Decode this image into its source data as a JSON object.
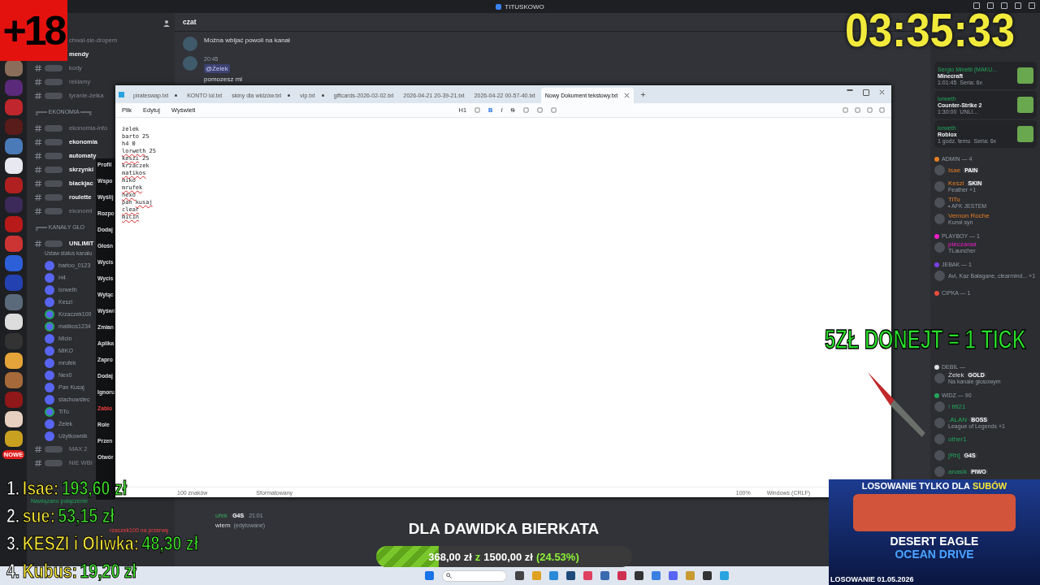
{
  "window": {
    "title": "TITUSKOWO"
  },
  "age_badge": "+18",
  "timer": "03:35:33",
  "channels": {
    "items": [
      {
        "kind": "text",
        "name": "chwal-sie-dropem",
        "unread": false
      },
      {
        "kind": "text",
        "name": "mendy",
        "unread": true
      },
      {
        "kind": "text",
        "name": "kody",
        "unread": false
      },
      {
        "kind": "text",
        "name": "reklamy",
        "unread": false
      },
      {
        "kind": "text",
        "name": "tyranie-żelka",
        "unread": false
      },
      {
        "kind": "category",
        "name": "╔══ EKONOMIA ══╗"
      },
      {
        "kind": "text",
        "name": "ekonomia-info",
        "unread": false
      },
      {
        "kind": "text",
        "name": "ekonomia",
        "unread": true
      },
      {
        "kind": "text",
        "name": "automaty",
        "unread": true
      },
      {
        "kind": "text",
        "name": "skrzynki",
        "unread": true
      },
      {
        "kind": "text",
        "name": "blackjac",
        "unread": true
      },
      {
        "kind": "text",
        "name": "roulette",
        "unread": true
      },
      {
        "kind": "text",
        "name": "ekonomi",
        "unread": false
      },
      {
        "kind": "category",
        "name": "╔══ KANAŁY GŁO"
      },
      {
        "kind": "voice",
        "name": "UNLIMIT",
        "unread": true,
        "status": "Ustaw status kanału"
      }
    ],
    "voice_users": [
      {
        "name": "bartoo_0123",
        "speaking": false
      },
      {
        "name": "H4",
        "speaking": false
      },
      {
        "name": "lorweth",
        "speaking": false
      },
      {
        "name": "Keszi",
        "speaking": false
      },
      {
        "name": "Krzaczek100",
        "speaking": true
      },
      {
        "name": "matikos1234",
        "speaking": true
      },
      {
        "name": "Micin",
        "speaking": false
      },
      {
        "name": "MIKO",
        "speaking": false
      },
      {
        "name": "mrufek",
        "speaking": false
      },
      {
        "name": "Nex0",
        "speaking": false
      },
      {
        "name": "Pan Kusaj",
        "speaking": false
      },
      {
        "name": "stachuwstec",
        "speaking": false
      },
      {
        "name": "TiTo",
        "speaking": true
      },
      {
        "name": "Żelek",
        "speaking": false
      },
      {
        "name": "Użytkownik",
        "speaking": false
      }
    ],
    "more_voice": [
      "MAX 2",
      "NIE WBI"
    ],
    "new_badge": "NOWE",
    "connection": "Nawiązano połączenie"
  },
  "context_menu": [
    {
      "label": "Profil",
      "danger": false
    },
    {
      "label": "Wspo",
      "danger": false
    },
    {
      "label": "Wyślij",
      "danger": false
    },
    {
      "label": "Rozpo",
      "danger": false
    },
    {
      "label": "Dodaj",
      "danger": false
    },
    {
      "label": "Głośn",
      "danger": false
    },
    {
      "label": "Wycis",
      "danger": false
    },
    {
      "label": "Wycis",
      "danger": false
    },
    {
      "label": "Wyłąc",
      "danger": false
    },
    {
      "label": "Wyświ",
      "danger": false
    },
    {
      "label": "Zmian",
      "danger": false
    },
    {
      "label": "Aplika",
      "danger": false
    },
    {
      "label": "Zapro",
      "danger": false
    },
    {
      "label": "Dodaj",
      "danger": false
    },
    {
      "label": "Ignoru",
      "danger": false
    },
    {
      "label": "Zablo",
      "danger": true
    },
    {
      "label": "Role",
      "danger": false
    },
    {
      "label": "Przen",
      "danger": false
    },
    {
      "label": "Otwór",
      "danger": false
    }
  ],
  "chat": {
    "channel": "czat",
    "messages": [
      {
        "text": "Można wbijać powoli na kanał"
      },
      {
        "time": "20:45",
        "mention": "@Żelek",
        "text": "pomozesz mi"
      }
    ],
    "bottom": {
      "author": "ufek",
      "badge": "G4S",
      "time": "21:01",
      "text": "wiem",
      "edited": "(edytowane)",
      "notice": "rzaczek100 na przerwę"
    }
  },
  "members": {
    "activities": [
      {
        "user": "Sergio Minetti (MAKU...",
        "game": "Minecraft",
        "time": "1:01:45",
        "extra": "Seria: 6x"
      },
      {
        "user": "lorweth",
        "game": "Counter-Strike 2",
        "time": "1:30:00",
        "extra": "UNLI..."
      },
      {
        "user": "lorweth",
        "game": "Roblox",
        "time": "1 godz. temu",
        "extra": "Seria: 6x"
      }
    ],
    "groups": [
      {
        "title": "ADMIN — 4",
        "color": "#e67e22",
        "members": [
          {
            "name": "Isae",
            "badge": "PAIN"
          },
          {
            "name": "Keszi",
            "badge": "SKIN",
            "status": "Feather +1"
          },
          {
            "name": "TiTo",
            "status": "• AFK JESTEM"
          },
          {
            "name": "Vernon Roche",
            "status": "Kurwi syn"
          }
        ]
      },
      {
        "title": "PLAYBOY — 1",
        "color": "#e91ec8",
        "members": [
          {
            "name": "pieczaraa",
            "status": "TLauncher"
          }
        ]
      },
      {
        "title": "JEBAK — 1",
        "color": "#7b3fe4",
        "members": [
          {
            "status": "Avi, Kaz Bałagane, clearmind... +1"
          }
        ]
      },
      {
        "title": "CIPKA — 1",
        "color": "#e74c3c"
      },
      {
        "title": "DEBIL —",
        "color": "#dbdee1",
        "members": [
          {
            "name": "Żelek",
            "badge": "GOLD",
            "status": "Na kanale głosowym"
          }
        ]
      },
      {
        "title": "WIDZ — 90",
        "color": "#23a55a",
        "members": [
          {
            "name": "! fifi21"
          },
          {
            "name": ".ALAN",
            "badge": "BOSS",
            "status": "League of Legends +1"
          },
          {
            "name": "other1"
          },
          {
            "name": "[Rh]",
            "badge": "G4S"
          },
          {
            "name": "anasik",
            "badge": "PIWO"
          }
        ]
      }
    ]
  },
  "notepad": {
    "tabs": [
      {
        "label": "pirateswap.txt",
        "selected": false,
        "modified": true
      },
      {
        "label": "KONTO lol.txt",
        "selected": false,
        "modified": false
      },
      {
        "label": "skiny dla widzów.txt",
        "selected": false,
        "modified": true
      },
      {
        "label": "vip.txt",
        "selected": false,
        "modified": true
      },
      {
        "label": "giftcards-2026-02-02.txt",
        "selected": false,
        "modified": false
      },
      {
        "label": "2026-04-21 20-39-21.txt",
        "selected": false,
        "modified": false
      },
      {
        "label": "2026-04-22 00-57-40.txt",
        "selected": false,
        "modified": false
      },
      {
        "label": "Nowy Dokument tekstowy.txt",
        "selected": true,
        "modified": false
      }
    ],
    "menu": [
      "Plik",
      "Edytuj",
      "Wyświetl"
    ],
    "heading": "H1",
    "format": [
      "B",
      "I",
      "S"
    ],
    "lines": [
      [
        {
          "text": "żelek",
          "flagged": false
        }
      ],
      [
        {
          "text": "barto",
          "flagged": false
        },
        {
          "text": "25",
          "flagged": false
        }
      ],
      [
        {
          "text": "h4",
          "flagged": false
        },
        {
          "text": "0",
          "flagged": false
        }
      ],
      [
        {
          "text": "lorweth",
          "flagged": true
        },
        {
          "text": "25",
          "flagged": false
        }
      ],
      [
        {
          "text": "keszi",
          "flagged": true
        },
        {
          "text": "25",
          "flagged": false
        }
      ],
      [
        {
          "text": "krzaczek",
          "flagged": false
        }
      ],
      [
        {
          "text": "matikos",
          "flagged": true
        }
      ],
      [
        {
          "text": "miko",
          "flagged": false
        }
      ],
      [
        {
          "text": "mrufek",
          "flagged": true
        }
      ],
      [
        {
          "text": "nexo",
          "flagged": true
        }
      ],
      [
        {
          "text": "pan",
          "flagged": false
        },
        {
          "text": "kusaj",
          "flagged": true
        }
      ],
      [
        {
          "text": "clear",
          "flagged": true
        }
      ],
      [
        {
          "text": "micin",
          "flagged": true
        }
      ]
    ],
    "status": {
      "chars": "100 znaków",
      "format": "Sformatowany",
      "zoom": "100%",
      "eol": "Windows (CRLF)"
    }
  },
  "ticket_banner": "5ZŁ DONEJT = 1 TICK",
  "leaderboard": [
    {
      "rank": "1.",
      "name": "Isae:",
      "amount": "193,60 zł"
    },
    {
      "rank": "2.",
      "name": "sue:",
      "amount": "53,15 zł"
    },
    {
      "rank": "3.",
      "name": "KESZI i Oliwka:",
      "amount": "48,30 zł"
    },
    {
      "rank": "4.",
      "name": "Kubus:",
      "amount": "19,20 zł"
    }
  ],
  "goal": {
    "title": "DLA DAWIDKA BIERKATA",
    "current": "368,00 zł",
    "sep": "z",
    "target": "1500,00 zł",
    "percent": "(24.53%)",
    "level": 0.2453
  },
  "giveaway": {
    "title": "LOSOWANIE TYLKO DLA",
    "highlight": "SUBÓW",
    "name": "DESERT EAGLE",
    "skin": "OCEAN DRIVE",
    "date": "LOSOWANIE 01.05.2026"
  }
}
